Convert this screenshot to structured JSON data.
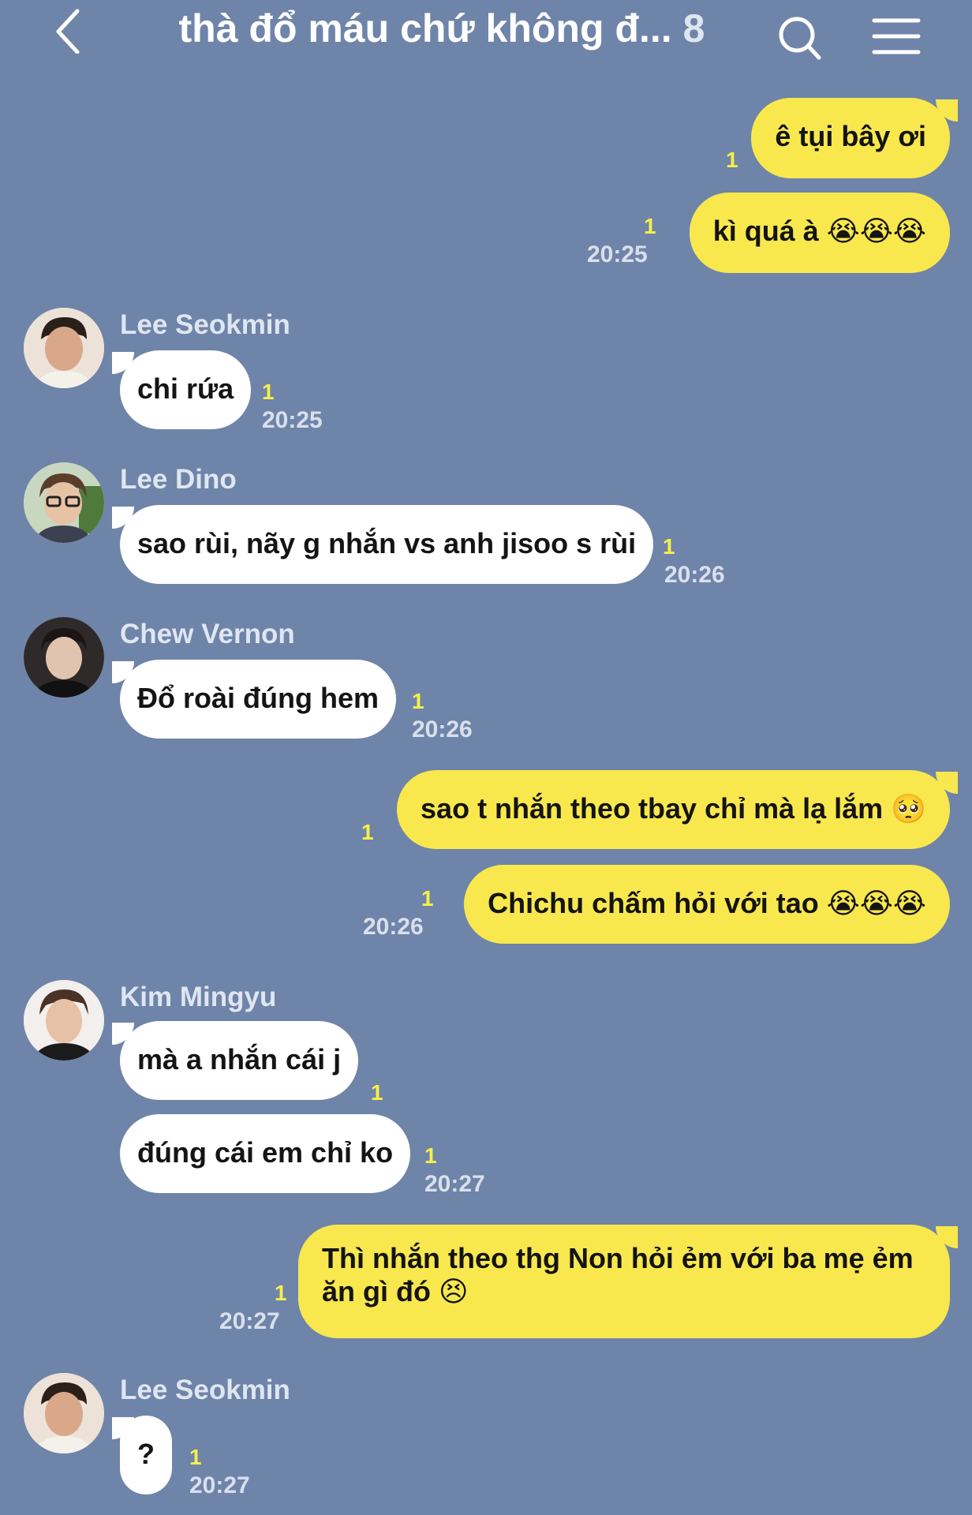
{
  "header": {
    "title": "thà đổ máu chứ không đ...",
    "member_count": "8"
  },
  "messages": [
    {
      "side": "out",
      "text": "ê tụi bây ơi",
      "read": "1"
    },
    {
      "side": "out",
      "text": "kì quá à 😭😭😭",
      "read": "1",
      "time": "20:25"
    },
    {
      "side": "in",
      "sender": "Lee Seokmin",
      "text": "chi rứa",
      "read": "1",
      "time": "20:25"
    },
    {
      "side": "in",
      "sender": "Lee Dino",
      "text": "sao rùi, nãy g nhắn vs anh jisoo s rùi",
      "read": "1",
      "time": "20:26"
    },
    {
      "side": "in",
      "sender": "Chew Vernon",
      "text": "Đổ roài đúng hem",
      "read": "1",
      "time": "20:26"
    },
    {
      "side": "out",
      "text": "sao t nhắn theo tbay chỉ mà lạ lắm 🥺",
      "read": "1"
    },
    {
      "side": "out",
      "text": "Chichu chấm hỏi với tao 😭😭😭",
      "read": "1",
      "time": "20:26"
    },
    {
      "side": "in",
      "sender": "Kim Mingyu",
      "text": "mà a nhắn cái j",
      "read": "1"
    },
    {
      "side": "in",
      "text": "đúng cái em chỉ ko",
      "read": "1",
      "time": "20:27"
    },
    {
      "side": "out",
      "text": "Thì nhắn theo thg Non hỏi ẻm với ba mẹ ẻm ăn gì đó 😣",
      "read": "1",
      "time": "20:27"
    },
    {
      "side": "in",
      "sender": "Lee Seokmin",
      "text": "?",
      "read": "1",
      "time": "20:27"
    }
  ],
  "colors": {
    "background": "#6f84a9",
    "outgoing_bubble": "#f8e84e",
    "incoming_bubble": "#ffffff",
    "read_receipt": "#f6ef4a"
  },
  "icons": [
    "back-chevron-icon",
    "search-icon",
    "hamburger-menu-icon"
  ]
}
